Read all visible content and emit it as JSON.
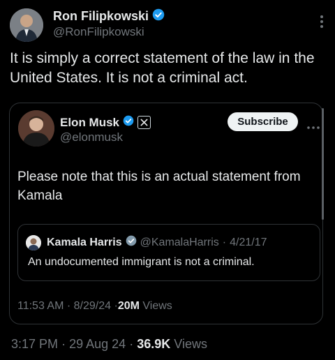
{
  "colors": {
    "background": "#000000",
    "primary_text": "#e7e9ea",
    "secondary_text": "#71767b",
    "verified_blue": "#1d9bf0",
    "border": "#2f3336",
    "button_bg": "#eff3f4"
  },
  "main_post": {
    "author_name": "Ron Filipkowski",
    "handle": "@RonFilipkowski",
    "text": "It is simply a correct statement of the law in the United States. It is not a criminal act.",
    "time": "3:17 PM",
    "date": "29 Aug 24",
    "views_count": "36.9K",
    "views_label": "Views",
    "separator": "·"
  },
  "quoted_post": {
    "author_name": "Elon Musk",
    "handle": "@elonmusk",
    "affiliate_icon": "x-logo-icon",
    "subscribe_label": "Subscribe",
    "text": "Please note that this is an actual statement from Kamala",
    "time": "11:53 AM",
    "date": "8/29/24",
    "views_count": "20M",
    "views_label": "Views",
    "separator": "·"
  },
  "nested_post": {
    "author_name": "Kamala Harris",
    "handle": "@KamalaHarris",
    "date": "4/21/17",
    "separator": "·",
    "text": "An undocumented immigrant is not a criminal."
  }
}
